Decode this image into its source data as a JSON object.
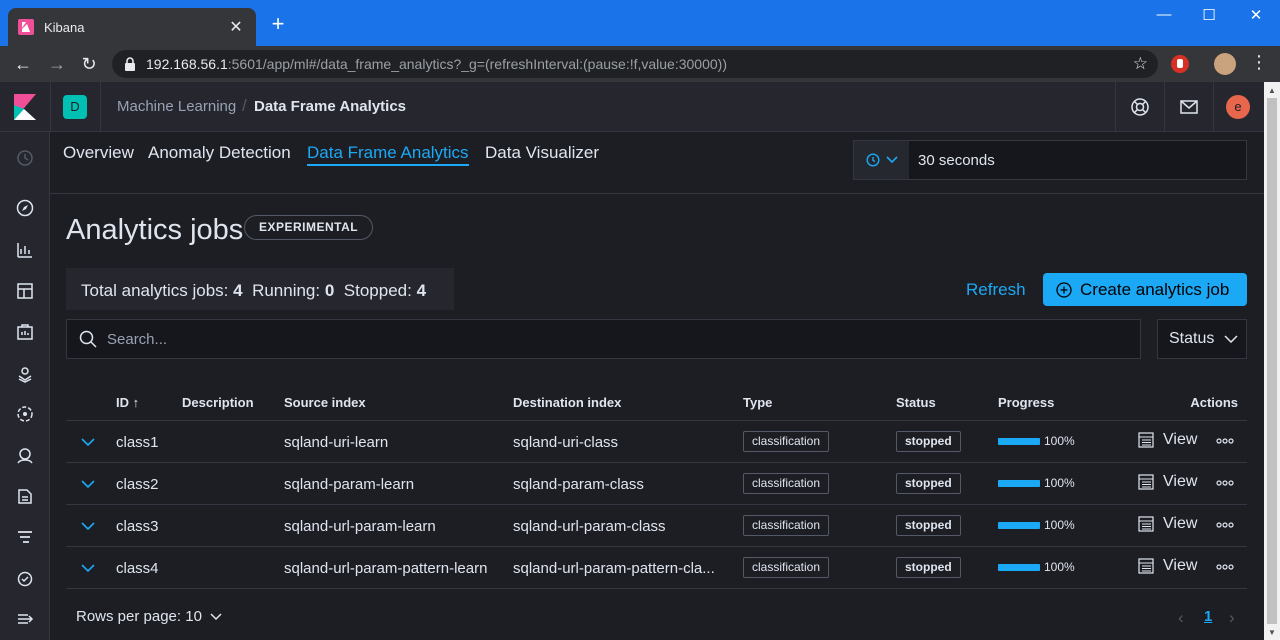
{
  "browser": {
    "tab_title": "Kibana",
    "new_tab": "+",
    "url_host": "192.168.56.1",
    "url_rest": ":5601/app/ml#/data_frame_analytics?_g=(refreshInterval:(pause:!f,value:30000))",
    "window_controls": [
      "—",
      "☐",
      "✕"
    ]
  },
  "header": {
    "space_initial": "D",
    "breadcrumbs": [
      "Machine Learning",
      "Data Frame Analytics"
    ],
    "avatar_initial": "e"
  },
  "ml_tabs": [
    "Overview",
    "Anomaly Detection",
    "Data Frame Analytics",
    "Data Visualizer"
  ],
  "active_tab": "Data Frame Analytics",
  "refresh_interval": "30 seconds",
  "page": {
    "title": "Analytics jobs",
    "badge": "EXPERIMENTAL",
    "stats": {
      "total_label": "Total analytics jobs:",
      "total": "4",
      "running_label": "Running:",
      "running": "0",
      "stopped_label": "Stopped:",
      "stopped": "4"
    },
    "refresh_label": "Refresh",
    "create_label": "Create analytics job",
    "search_placeholder": "Search...",
    "status_filter": "Status"
  },
  "table": {
    "columns": [
      "ID",
      "Description",
      "Source index",
      "Destination index",
      "Type",
      "Status",
      "Progress",
      "Actions"
    ],
    "rows": [
      {
        "id": "class1",
        "description": "",
        "source": "sqland-uri-learn",
        "dest": "sqland-uri-class",
        "type": "classification",
        "status": "stopped",
        "progress": 100,
        "progress_label": "100%",
        "action": "View"
      },
      {
        "id": "class2",
        "description": "",
        "source": "sqland-param-learn",
        "dest": "sqland-param-class",
        "type": "classification",
        "status": "stopped",
        "progress": 100,
        "progress_label": "100%",
        "action": "View"
      },
      {
        "id": "class3",
        "description": "",
        "source": "sqland-url-param-learn",
        "dest": "sqland-url-param-class",
        "type": "classification",
        "status": "stopped",
        "progress": 100,
        "progress_label": "100%",
        "action": "View"
      },
      {
        "id": "class4",
        "description": "",
        "source": "sqland-url-param-pattern-learn",
        "dest": "sqland-url-param-pattern-cla...",
        "type": "classification",
        "status": "stopped",
        "progress": 100,
        "progress_label": "100%",
        "action": "View"
      }
    ]
  },
  "pagination": {
    "rows_per_page": "Rows per page: 10",
    "current_page": "1"
  },
  "colors": {
    "accent": "#1ba9f5",
    "background": "#1d1e24",
    "panel": "#25262e",
    "browser_blue": "#1a73e8"
  }
}
